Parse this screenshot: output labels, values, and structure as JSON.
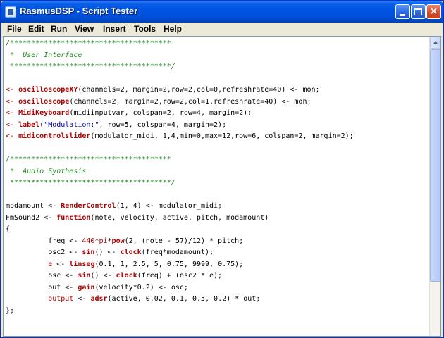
{
  "window": {
    "title": "RasmusDSP - Script Tester",
    "controls": {
      "minimize": "minimize",
      "maximize": "maximize",
      "close": "×"
    }
  },
  "menu": {
    "items": [
      {
        "label": "File"
      },
      {
        "label": "Edit"
      },
      {
        "label": "Run"
      },
      {
        "label": "View"
      },
      {
        "label": "Insert"
      },
      {
        "label": "Tools"
      },
      {
        "label": "Help"
      }
    ]
  },
  "code": {
    "lines": [
      [
        {
          "t": "/**************************************",
          "c": "cm"
        }
      ],
      [
        {
          "t": " *  User Interface",
          "c": "cm"
        }
      ],
      [
        {
          "t": " **************************************/",
          "c": "cm"
        }
      ],
      [
        {
          "t": "",
          "c": ""
        }
      ],
      [
        {
          "t": "<- ",
          "c": "var-red"
        },
        {
          "t": "oscilloscopeXY",
          "c": "fn"
        },
        {
          "t": "(channels=2, margin=2,row=2,col=0,refreshrate=40) <- mon;",
          "c": ""
        }
      ],
      [
        {
          "t": "<- ",
          "c": "var-red"
        },
        {
          "t": "oscilloscope",
          "c": "fn"
        },
        {
          "t": "(channels=2, margin=2,row=2,col=1,refreshrate=40) <- mon;",
          "c": ""
        }
      ],
      [
        {
          "t": "<- ",
          "c": "var-red"
        },
        {
          "t": "MidiKeyboard",
          "c": "fn"
        },
        {
          "t": "(midiinputvar, colspan=2, row=4, margin=2);",
          "c": ""
        }
      ],
      [
        {
          "t": "<- ",
          "c": "var-red"
        },
        {
          "t": "label",
          "c": "fn"
        },
        {
          "t": "(",
          "c": ""
        },
        {
          "t": "\"Modulation:\"",
          "c": "str"
        },
        {
          "t": ", row=5, colspan=4, margin=2);",
          "c": ""
        }
      ],
      [
        {
          "t": "<- ",
          "c": "var-red"
        },
        {
          "t": "midicontrolslider",
          "c": "fn"
        },
        {
          "t": "(modulator_midi, 1,4,min=0,max=12,row=6, colspan=2, margin=2);",
          "c": ""
        }
      ],
      [
        {
          "t": "",
          "c": ""
        }
      ],
      [
        {
          "t": "/**************************************",
          "c": "cm"
        }
      ],
      [
        {
          "t": " *  Audio Synthesis",
          "c": "cm"
        }
      ],
      [
        {
          "t": " **************************************/",
          "c": "cm"
        }
      ],
      [
        {
          "t": "",
          "c": ""
        }
      ],
      [
        {
          "t": "modamount <- ",
          "c": ""
        },
        {
          "t": "RenderControl",
          "c": "fn"
        },
        {
          "t": "(1, 4) <- modulator_midi;",
          "c": ""
        }
      ],
      [
        {
          "t": "FmSound2 <- ",
          "c": ""
        },
        {
          "t": "function",
          "c": "fn"
        },
        {
          "t": "(note, velocity, active, pitch, modamount)",
          "c": ""
        }
      ],
      [
        {
          "t": "{",
          "c": ""
        }
      ],
      [
        {
          "t": "          freq <- ",
          "c": ""
        },
        {
          "t": "440",
          "c": "var-red"
        },
        {
          "t": "*",
          "c": ""
        },
        {
          "t": "pi",
          "c": "var-red"
        },
        {
          "t": "*",
          "c": ""
        },
        {
          "t": "pow",
          "c": "fn"
        },
        {
          "t": "(2, (note - 57)/12) * pitch;",
          "c": ""
        }
      ],
      [
        {
          "t": "          osc2 <- ",
          "c": ""
        },
        {
          "t": "sin",
          "c": "fn"
        },
        {
          "t": "() <- ",
          "c": ""
        },
        {
          "t": "clock",
          "c": "fn"
        },
        {
          "t": "(freq*modamount);",
          "c": ""
        }
      ],
      [
        {
          "t": "          ",
          "c": ""
        },
        {
          "t": "e",
          "c": "var-red"
        },
        {
          "t": " <- ",
          "c": ""
        },
        {
          "t": "linseg",
          "c": "fn"
        },
        {
          "t": "(0.1, 1, 2.5, 5, 0.75, 9999, 0.75);",
          "c": ""
        }
      ],
      [
        {
          "t": "          osc <- ",
          "c": ""
        },
        {
          "t": "sin",
          "c": "fn"
        },
        {
          "t": "() <- ",
          "c": ""
        },
        {
          "t": "clock",
          "c": "fn"
        },
        {
          "t": "(freq) + (osc2 * e);",
          "c": ""
        }
      ],
      [
        {
          "t": "          out <- ",
          "c": ""
        },
        {
          "t": "gain",
          "c": "fn"
        },
        {
          "t": "(velocity*0.2) <- osc;",
          "c": ""
        }
      ],
      [
        {
          "t": "          ",
          "c": ""
        },
        {
          "t": "output",
          "c": "var-red"
        },
        {
          "t": " <- ",
          "c": ""
        },
        {
          "t": "adsr",
          "c": "fn"
        },
        {
          "t": "(active, 0.02, 0.1, 0.5, 0.2) * out;",
          "c": ""
        }
      ],
      [
        {
          "t": "};",
          "c": ""
        }
      ]
    ]
  }
}
